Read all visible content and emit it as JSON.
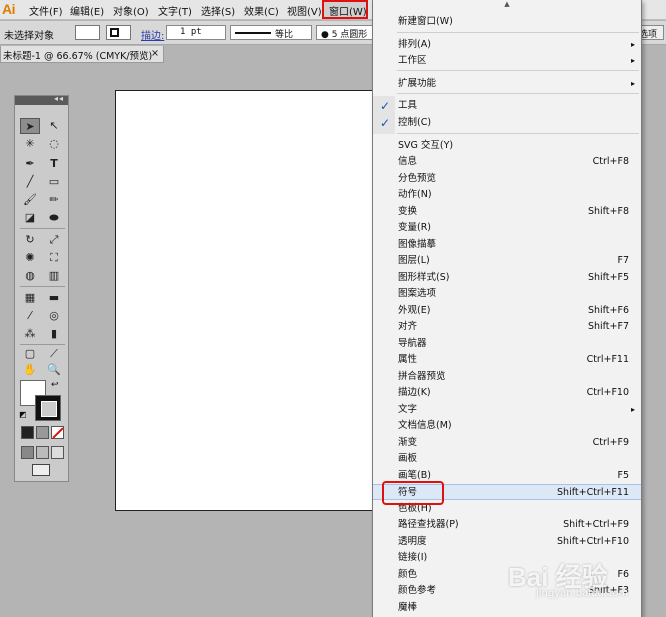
{
  "app": {
    "logo": "Ai"
  },
  "menubar": {
    "items": [
      "文件(F)",
      "编辑(E)",
      "对象(O)",
      "文字(T)",
      "选择(S)",
      "效果(C)",
      "视图(V)",
      "窗口(W)"
    ]
  },
  "controlbar": {
    "selection_status": "未选择对象",
    "stroke_label": "描边:",
    "stroke_weight": "1 pt",
    "stroke_style": "等比",
    "brush_definition": "● 5 点圆形",
    "options_label": "选项"
  },
  "document": {
    "tab_title": "未标题-1 @ 66.67% (CMYK/预览)",
    "close_glyph": "×"
  },
  "tools_panel": {
    "collapse_glyph": "◂◂"
  },
  "window_menu": {
    "scroll_up_glyph": "▲",
    "groups": [
      [
        {
          "label": "新建窗口(W)",
          "shortcut": ""
        }
      ],
      [
        {
          "label": "排列(A)",
          "shortcut": "",
          "submenu": true
        },
        {
          "label": "工作区",
          "shortcut": "",
          "submenu": true
        }
      ],
      [
        {
          "label": "扩展功能",
          "shortcut": "",
          "submenu": true
        }
      ],
      [
        {
          "label": "工具",
          "shortcut": "",
          "checked": true
        },
        {
          "label": "控制(C)",
          "shortcut": "",
          "checked": true
        }
      ],
      [
        {
          "label": "SVG 交互(Y)",
          "shortcut": ""
        },
        {
          "label": "信息",
          "shortcut": "Ctrl+F8"
        },
        {
          "label": "分色预览",
          "shortcut": ""
        },
        {
          "label": "动作(N)",
          "shortcut": ""
        },
        {
          "label": "变换",
          "shortcut": "Shift+F8"
        },
        {
          "label": "变量(R)",
          "shortcut": ""
        },
        {
          "label": "图像描摹",
          "shortcut": ""
        },
        {
          "label": "图层(L)",
          "shortcut": "F7"
        },
        {
          "label": "图形样式(S)",
          "shortcut": "Shift+F5"
        },
        {
          "label": "图案选项",
          "shortcut": ""
        },
        {
          "label": "外观(E)",
          "shortcut": "Shift+F6"
        },
        {
          "label": "对齐",
          "shortcut": "Shift+F7"
        },
        {
          "label": "导航器",
          "shortcut": ""
        },
        {
          "label": "属性",
          "shortcut": "Ctrl+F11"
        },
        {
          "label": "拼合器预览",
          "shortcut": ""
        },
        {
          "label": "描边(K)",
          "shortcut": "Ctrl+F10"
        },
        {
          "label": "文字",
          "shortcut": "",
          "submenu": true
        },
        {
          "label": "文档信息(M)",
          "shortcut": ""
        },
        {
          "label": "渐变",
          "shortcut": "Ctrl+F9"
        },
        {
          "label": "画板",
          "shortcut": ""
        },
        {
          "label": "画笔(B)",
          "shortcut": "F5"
        },
        {
          "label": "符号",
          "shortcut": "Shift+Ctrl+F11",
          "hover": true
        },
        {
          "label": "色板(H)",
          "shortcut": ""
        },
        {
          "label": "路径查找器(P)",
          "shortcut": "Shift+Ctrl+F9"
        },
        {
          "label": "透明度",
          "shortcut": "Shift+Ctrl+F10"
        },
        {
          "label": "链接(I)",
          "shortcut": ""
        },
        {
          "label": "颜色",
          "shortcut": "F6"
        },
        {
          "label": "颜色参考",
          "shortcut": "Shift+F3"
        },
        {
          "label": "魔棒",
          "shortcut": ""
        }
      ]
    ],
    "submenu_glyph": "▸",
    "check_glyph": "✓"
  },
  "watermark": {
    "brand": "Bai 经验",
    "url": "jingyan.baidu.com"
  },
  "colors": {
    "highlight_border": "#e01010",
    "hover_bg": "#dde8f6",
    "check_color": "#1d4fc4",
    "logo_color": "#e07b00"
  }
}
